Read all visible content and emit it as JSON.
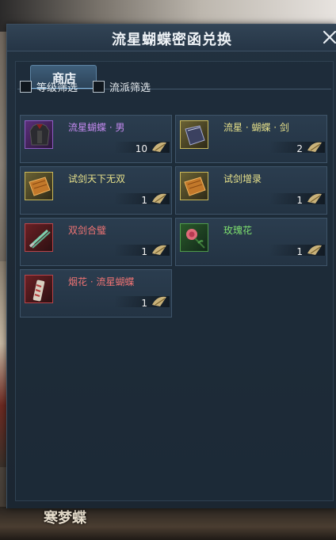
{
  "window": {
    "title": "流星蝴蝶密函兑换",
    "close_symbol": "✕"
  },
  "tabs": [
    {
      "label": "商店",
      "active": true
    }
  ],
  "filters": [
    {
      "label": "等级筛选",
      "checked": false
    },
    {
      "label": "流派筛选",
      "checked": false
    }
  ],
  "items": [
    {
      "name": "流星蝴蝶 · 男",
      "qty": "10",
      "name_color": "#c48af0",
      "icon": "armor-icon",
      "rarity_color": "#8e5cc4"
    },
    {
      "name": "流星 · 蝴蝶 · 剑",
      "qty": "2",
      "name_color": "#e6e08a",
      "icon": "book-icon",
      "rarity_color": "#c9b85a"
    },
    {
      "name": "试剑天下无双",
      "qty": "1",
      "name_color": "#e6e08a",
      "icon": "scroll-book-icon",
      "rarity_color": "#c9b85a"
    },
    {
      "name": "试剑增录",
      "qty": "1",
      "name_color": "#e6e08a",
      "icon": "scroll-book-icon",
      "rarity_color": "#c9b85a"
    },
    {
      "name": "双剑合璧",
      "qty": "1",
      "name_color": "#f07474",
      "icon": "twin-swords-icon",
      "rarity_color": "#b8444a"
    },
    {
      "name": "玫瑰花",
      "qty": "1",
      "name_color": "#7ee06e",
      "icon": "rose-icon",
      "rarity_color": "#4f9a4a"
    },
    {
      "name": "烟花 · 流星蝴蝶",
      "qty": "1",
      "name_color": "#f07474",
      "icon": "firework-icon",
      "rarity_color": "#b8444a"
    }
  ],
  "currency_icon": "letter-token-icon",
  "background": {
    "caption": "寒梦蝶"
  }
}
